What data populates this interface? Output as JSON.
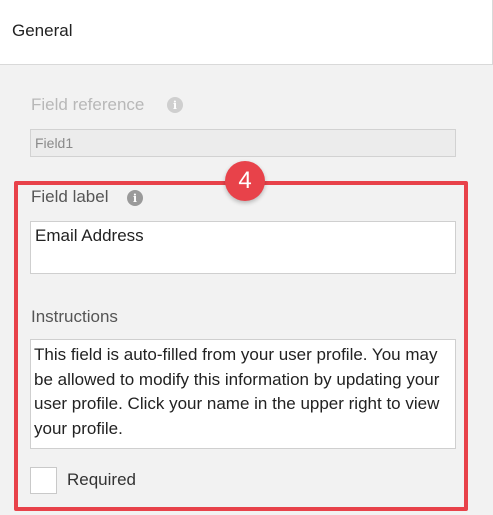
{
  "header": {
    "title": "General"
  },
  "field_reference": {
    "label": "Field reference",
    "value": "Field1",
    "info_icon": "info-icon"
  },
  "field_label": {
    "label": "Field label",
    "value": "Email Address",
    "info_icon": "info-icon"
  },
  "instructions": {
    "label": "Instructions",
    "value": "This field is auto-filled from your user profile. You may be allowed to modify this information by updating your user profile. Click your name in the upper right to view your profile."
  },
  "required": {
    "label": "Required",
    "checked": false
  },
  "annotation": {
    "step_number": "4",
    "color": "#e8424a"
  }
}
